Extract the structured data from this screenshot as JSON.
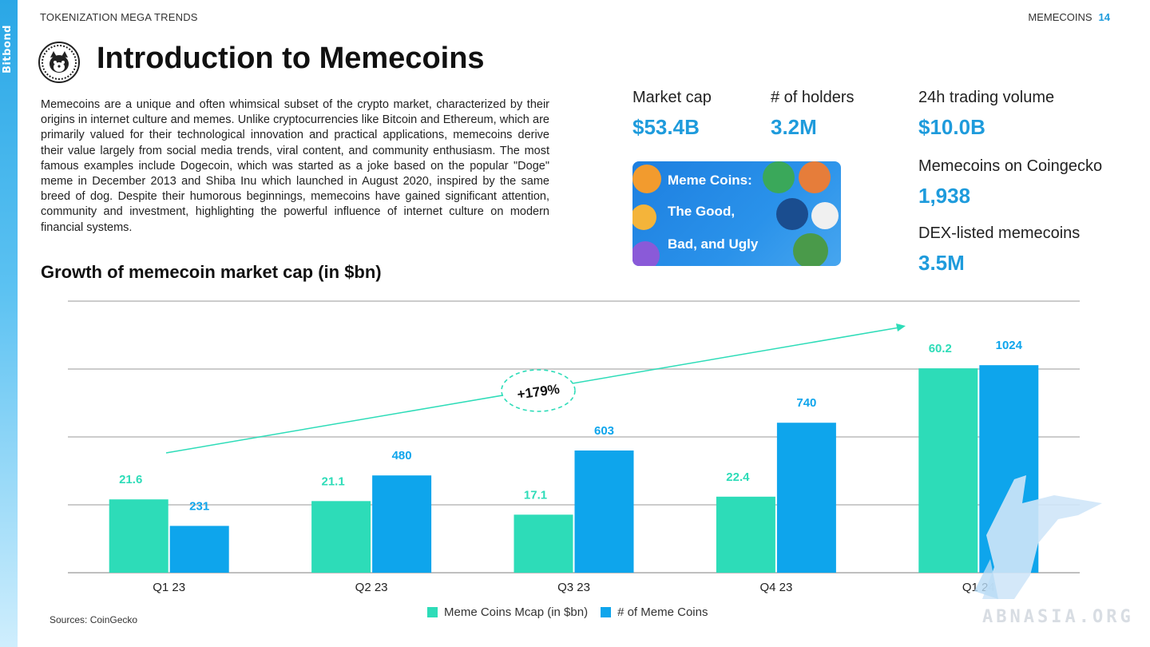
{
  "brand": "Bitbond",
  "header": {
    "left": "TOKENIZATION MEGA TRENDS",
    "right": "MEMECOINS",
    "page": "14"
  },
  "title": "Introduction to Memecoins",
  "intro": "Memecoins are a unique and often whimsical subset of the crypto market, characterized by their origins in internet culture and memes. Unlike cryptocurrencies like Bitcoin and Ethereum, which are primarily valued for their technological innovation and practical applications, memecoins derive their value largely from social media trends, viral content, and community enthusiasm. The most famous examples include Dogecoin, which was started as a joke based on the popular \"Doge\" meme in December 2013 and Shiba Inu which launched in August 2020, inspired by the same breed of dog. Despite their humorous beginnings, memecoins have gained significant attention, community and investment, highlighting the powerful influence of internet culture on modern financial systems.",
  "stats": {
    "market_cap": {
      "label": "Market cap",
      "value": "$53.4B"
    },
    "holders": {
      "label": "# of holders",
      "value": "3.2M"
    },
    "volume": {
      "label": "24h trading volume",
      "value": "$10.0B"
    },
    "coingecko": {
      "label": "Memecoins on Coingecko",
      "value": "1,938"
    },
    "dex": {
      "label": "DEX-listed memecoins",
      "value": "3.5M"
    }
  },
  "banner": {
    "line1": "Meme Coins:",
    "line2": "The Good,",
    "line3": "Bad, and Ugly"
  },
  "chart_title": "Growth of memecoin market cap (in $bn)",
  "chart_data": {
    "type": "bar",
    "categories": [
      "Q1 23",
      "Q2 23",
      "Q3 23",
      "Q4 23",
      "Q1 24"
    ],
    "series": [
      {
        "name": "Meme Coins Mcap (in $bn)",
        "values": [
          21.6,
          21.1,
          17.1,
          22.4,
          60.2
        ],
        "color": "#2ddcb8"
      },
      {
        "name": "# of Meme Coins",
        "values": [
          231,
          480,
          603,
          740,
          1024
        ],
        "color": "#0ea5ec"
      }
    ],
    "annotation": "+179%"
  },
  "sources": "Sources: CoinGecko",
  "watermark": "ABNASIA.ORG"
}
